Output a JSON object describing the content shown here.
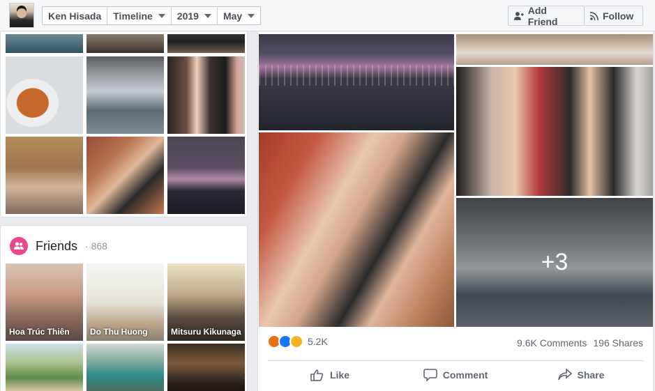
{
  "topbar": {
    "profile_name": "Ken Hisada",
    "crumbs": [
      "Timeline",
      "2019",
      "May"
    ],
    "add_friend_label": "Add Friend",
    "follow_label": "Follow"
  },
  "photos_card": {
    "tiles": [
      "water",
      "crowd",
      "night-street",
      "food",
      "store",
      "selfie-store",
      "restaurant",
      "tiles-selfie",
      "skyline"
    ]
  },
  "friends": {
    "title": "Friends",
    "count": "868",
    "items": [
      {
        "name": "Hoa Trúc Thiên"
      },
      {
        "name": "Do Thu Huong"
      },
      {
        "name": "Mitsuru Kikunaga"
      },
      {
        "name": ""
      },
      {
        "name": ""
      },
      {
        "name": ""
      }
    ]
  },
  "post": {
    "more_photos": "+3",
    "reaction_count": "5.2K",
    "comments": "9.6K Comments",
    "shares": "196 Shares",
    "actions": {
      "like": "Like",
      "comment": "Comment",
      "share": "Share"
    },
    "reaction_icons": [
      "angry-icon",
      "like-icon",
      "haha-icon"
    ]
  },
  "colors": {
    "bar_bg": "#f6f7f9",
    "friends_badge": "#e64a8a",
    "like_blue": "#1877f2",
    "angry_orange": "#e9710f",
    "haha_yellow": "#f7b125"
  }
}
